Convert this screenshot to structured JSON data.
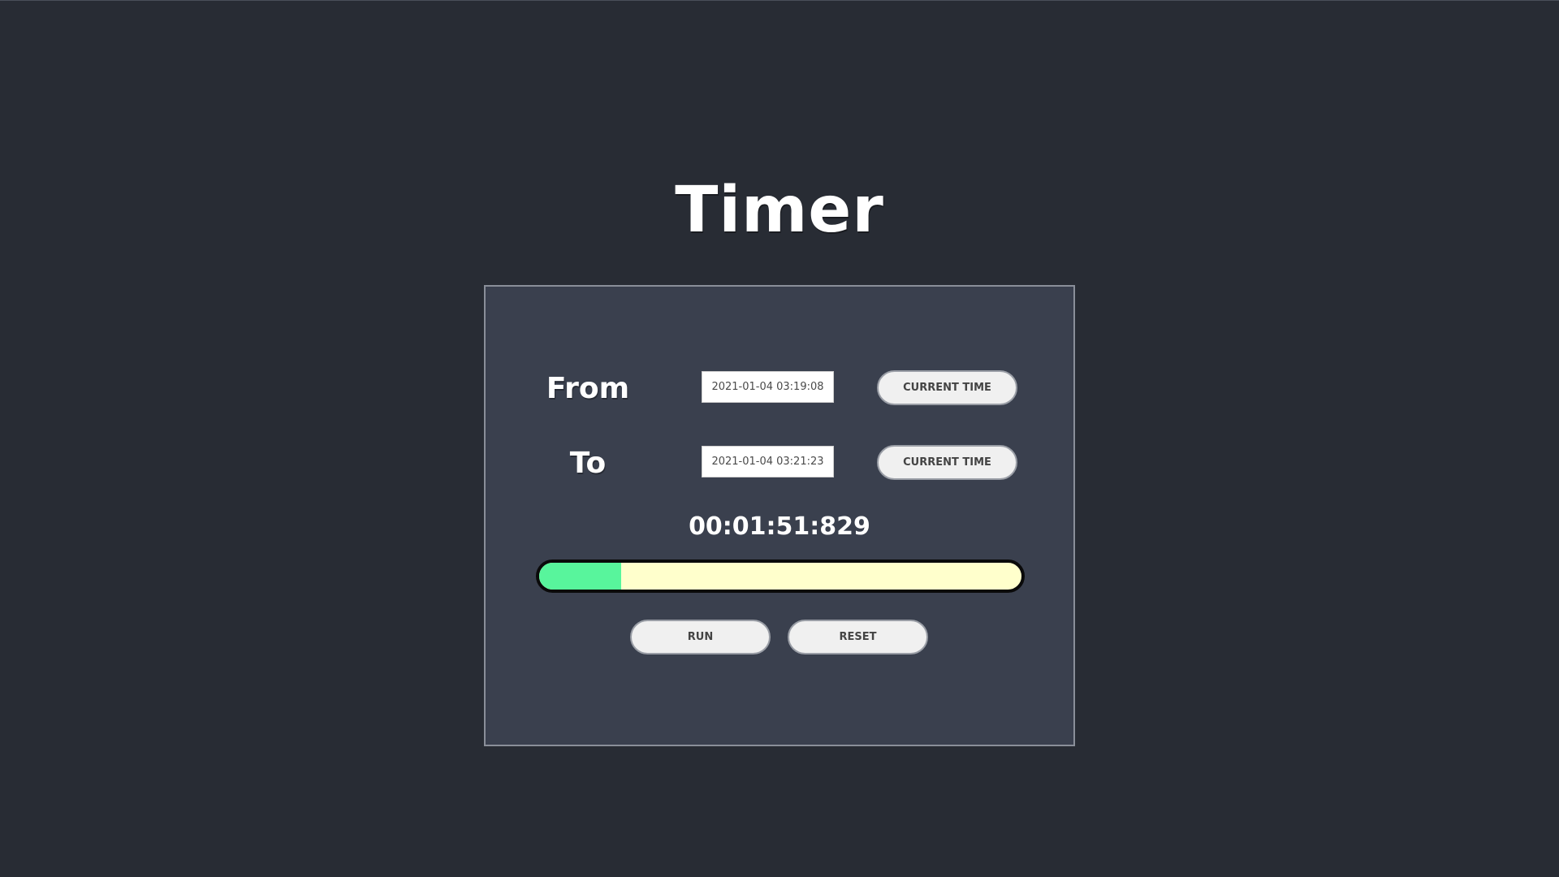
{
  "app": {
    "title": "Timer"
  },
  "from": {
    "label": "From",
    "value": "2021-01-04 03:19:08",
    "button_label": "CURRENT TIME"
  },
  "to": {
    "label": "To",
    "value": "2021-01-04 03:21:23",
    "button_label": "CURRENT TIME"
  },
  "elapsed": "00:01:51:829",
  "progress": {
    "fraction": 0.17,
    "fill_color": "#58f59c",
    "track_color": "#ffffcc"
  },
  "controls": {
    "run_label": "RUN",
    "reset_label": "RESET"
  },
  "colors": {
    "background": "#282c34",
    "panel": "#3a404e"
  }
}
